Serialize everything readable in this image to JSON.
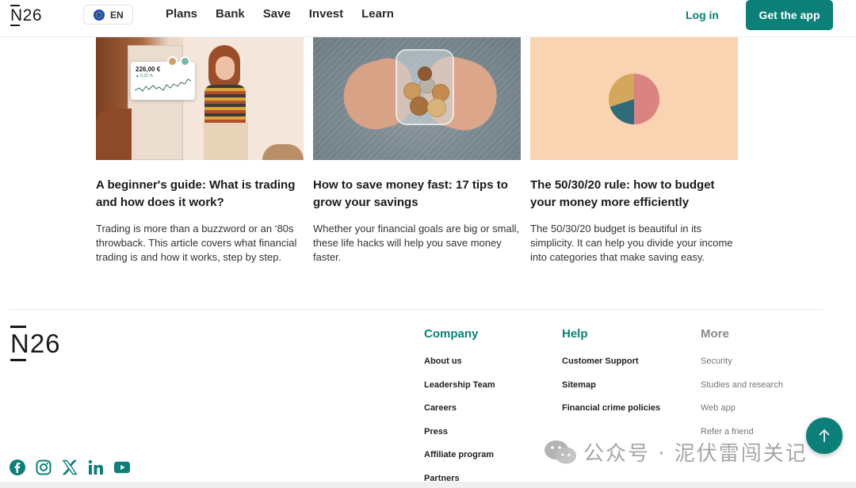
{
  "header": {
    "logo": "N26",
    "language": "EN",
    "nav": [
      "Plans",
      "Bank",
      "Save",
      "Invest",
      "Learn"
    ],
    "login": "Log in",
    "cta": "Get the app"
  },
  "articles": [
    {
      "title": "A beginner's guide: What is trading and how does it work?",
      "excerpt": "Trading is more than a buzzword or an ‘80s throwback. This article covers what financial trading is and how it works, step by step.",
      "widget_amount": "226,00 €",
      "widget_change": "▲ 0,21 %"
    },
    {
      "title": "How to save money fast: 17 tips to grow your savings",
      "excerpt": "Whether your financial goals are big or small, these life hacks will help you save money faster."
    },
    {
      "title": "The 50/30/20 rule: how to budget your money more efficiently",
      "excerpt": "The 50/30/20 budget is beautiful in its simplicity. It can help you divide your income into categories that make saving easy.",
      "pie": [
        {
          "share": 50,
          "color": "#d98480"
        },
        {
          "share": 20,
          "color": "#2f6b78"
        },
        {
          "share": 30,
          "color": "#d4a75c"
        }
      ]
    }
  ],
  "footer": {
    "logo": "N26",
    "company": {
      "heading": "Company",
      "links": [
        "About us",
        "Leadership Team",
        "Careers",
        "Press",
        "Affiliate program",
        "Partners"
      ]
    },
    "help": {
      "heading": "Help",
      "links": [
        "Customer Support",
        "Sitemap",
        "Financial crime policies"
      ]
    },
    "more": {
      "heading": "More",
      "links": [
        "Security",
        "Studies and research",
        "Web app",
        "Refer a friend"
      ]
    },
    "social": [
      "facebook-icon",
      "instagram-icon",
      "x-icon",
      "linkedin-icon",
      "youtube-icon"
    ]
  },
  "watermark": "公众号 · 泥伏雷闯关记",
  "colors": {
    "brand": "#0b7f78",
    "text": "#1a1a1a"
  }
}
